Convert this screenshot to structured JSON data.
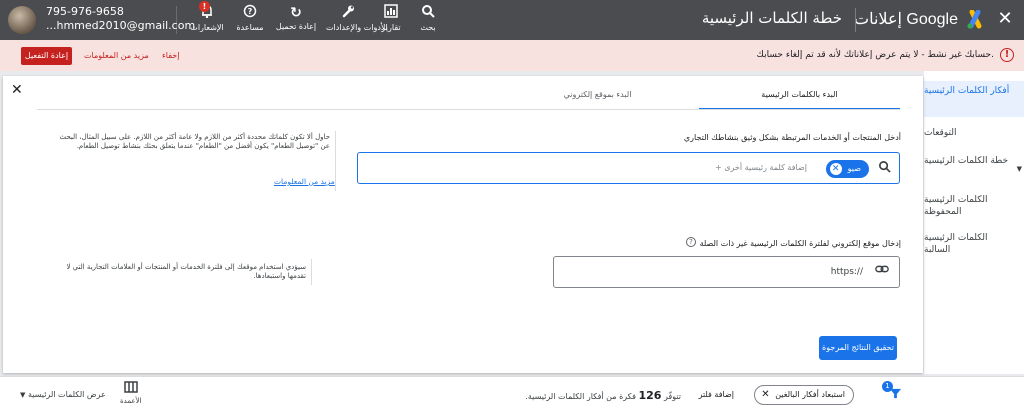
{
  "header": {
    "brand": "إعلانات Google",
    "page_title": "خطة الكلمات الرئيسية",
    "tools": [
      {
        "icon": "search-icon",
        "glyph": "⚲",
        "label": "بحث"
      },
      {
        "icon": "reports-icon",
        "glyph": "▥",
        "label": "تقارير"
      },
      {
        "icon": "tools-icon",
        "glyph": "✎",
        "label": "الأدوات والإعدادات"
      },
      {
        "icon": "refresh-icon",
        "glyph": "↻",
        "label": "إعادة تحميل"
      },
      {
        "icon": "help-icon",
        "glyph": "?",
        "label": "مساعدة"
      },
      {
        "icon": "notifications-icon",
        "glyph": "🔔",
        "label": "الإشعارات"
      }
    ],
    "notifications_badge": "!",
    "account_id": "795-976-9658",
    "account_email": "...hmmed2010@gmail.com"
  },
  "alert": {
    "icon": "!",
    "text": "حسابك غير نشط - لا يتم عرض إعلاناتك لأنه قد تم إلغاء حسابك.",
    "reactivate_label": "إعادة التفعيل",
    "more_info_label": "مزيد من المعلومات",
    "hide_label": "إخفاء"
  },
  "sidebar": {
    "items": [
      {
        "label": "أفكار الكلمات الرئيسية",
        "active": true
      },
      {
        "label": "التوقعات"
      },
      {
        "label": "خطة الكلمات الرئيسية",
        "expandable": true
      },
      {
        "label": "الكلمات الرئيسية المحفوظة"
      },
      {
        "label": "الكلمات الرئيسية السالبة"
      }
    ]
  },
  "main": {
    "tabs": [
      {
        "label": "البدء بالكلمات الرئيسية",
        "active": true
      },
      {
        "label": "البدء بموقع إلكتروني"
      }
    ],
    "keywords_label": "أدخل المنتجات أو الخدمات المرتبطة بشكل وثيق بنشاطك التجاري",
    "keyword_chip": "صيو",
    "add_keyword_placeholder": "+ إضافة كلمة رئيسية أخرى",
    "keywords_help": "حاول ألا تكون كلماتك محددة أكثر من اللازم ولا عامة أكثر من اللازم. على سبيل المثال، البحث عن \"توصيل الطعام\" يكون أفضل من \"الطعام\" عندما يتعلق بحثك بنشاط توصيل الطعام.",
    "keywords_help_link": "مزيد من المعلومات",
    "site_label": "إدخال موقع إلكتروني لفلترة الكلمات الرئيسية غير ذات الصلة",
    "site_value": "https://",
    "site_help": "سيؤدي استخدام موقعك إلى فلترة الخدمات أو المنتجات أو العلامات التجارية التي لا تقدمها واستبعادها.",
    "results_button": "تحقيق النتائج المرجوة"
  },
  "bottombar": {
    "filter_badge": "1",
    "exclude_chip": "استبعاد أفكار البالغين",
    "add_filter": "إضافة فلتر",
    "count_prefix": "تتوفّر",
    "count_value": "126",
    "count_suffix": "فكرة من أفكار الكلمات الرئيسية.",
    "columns_label": "الأعمدة",
    "view_label": "عرض الكلمات الرئيسية"
  },
  "colors": {
    "topbar": "#4a4c4f",
    "accent": "#1a73e8",
    "alert_bg": "#f8e2e0",
    "danger": "#c5221f"
  }
}
